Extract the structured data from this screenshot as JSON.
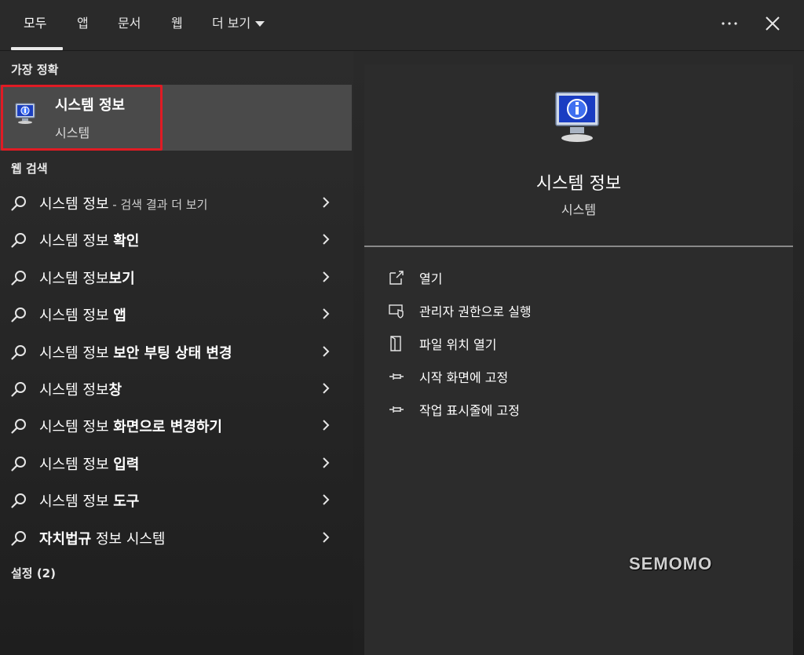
{
  "tabs": [
    {
      "label": "모두",
      "active": true
    },
    {
      "label": "앱"
    },
    {
      "label": "문서"
    },
    {
      "label": "웹"
    },
    {
      "label": "더 보기"
    }
  ],
  "toolbar": {
    "more_icon": "ellipsis-icon",
    "close_icon": "close-icon"
  },
  "sections": {
    "best_match": "가장 정확",
    "web_search": "웹 검색",
    "settings": "설정 (2)"
  },
  "best_match": {
    "title": "시스템 정보",
    "subtitle": "시스템",
    "icon": "system-info-icon"
  },
  "web_results": [
    {
      "query": "시스템 정보",
      "suffix": " - 검색 결과 더 보기"
    },
    {
      "query": "시스템 정보 확인",
      "bold_part": "확인"
    },
    {
      "query": "시스템 정보보기",
      "bold_part": "보기"
    },
    {
      "query": "시스템 정보 앱",
      "bold_part": "앱"
    },
    {
      "query": "시스템 정보 보안 부팅 상태 변경",
      "bold_part": "보안 부팅 상태 변경"
    },
    {
      "query": "시스템 정보창",
      "bold_part": "창"
    },
    {
      "query": "시스템 정보 화면으로 변경하기",
      "bold_part": "화면으로 변경하기"
    },
    {
      "query": "시스템 정보 입력",
      "bold_part": "입력"
    },
    {
      "query": "시스템 정보 도구",
      "bold_part": "도구"
    },
    {
      "query": "자치법규 정보 시스템",
      "bold_part": "자치법규"
    }
  ],
  "preview": {
    "title": "시스템 정보",
    "subtitle": "시스템"
  },
  "actions": [
    {
      "label": "열기",
      "icon": "open-icon"
    },
    {
      "label": "관리자 권한으로 실행",
      "icon": "admin-shield-icon"
    },
    {
      "label": "파일 위치 열기",
      "icon": "file-location-icon"
    },
    {
      "label": "시작 화면에 고정",
      "icon": "pin-icon"
    },
    {
      "label": "작업 표시줄에 고정",
      "icon": "pin-icon"
    }
  ],
  "watermark": "SEMOMO",
  "colors": {
    "highlight_border": "#e01b24",
    "selected_row": "#4a4a4a"
  }
}
